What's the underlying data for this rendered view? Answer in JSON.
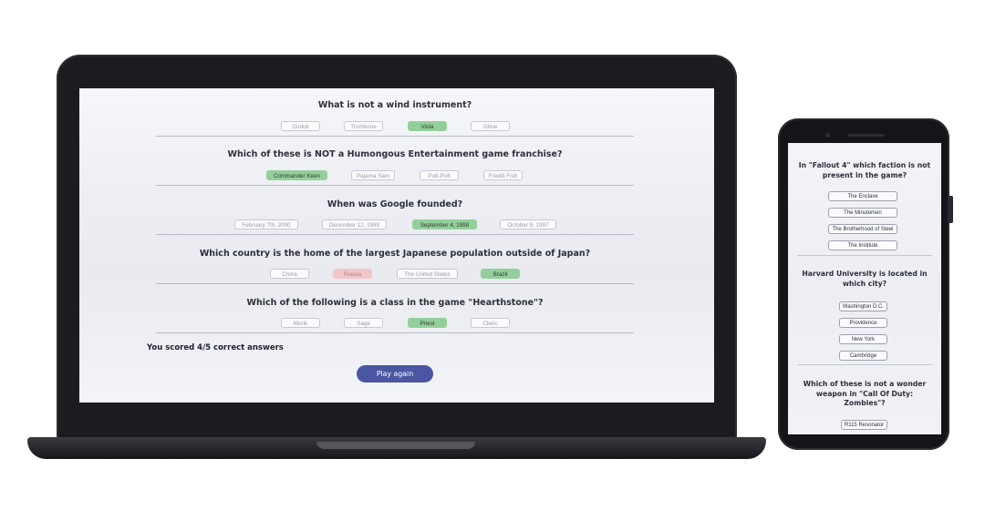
{
  "laptop": {
    "questions": [
      {
        "title": "What is not a wind instrument?",
        "options": [
          {
            "label": "Duduk",
            "state": "default"
          },
          {
            "label": "Trombone",
            "state": "default"
          },
          {
            "label": "Viola",
            "state": "correct"
          },
          {
            "label": "Oboe",
            "state": "default"
          }
        ]
      },
      {
        "title": "Which of these is NOT a Humongous Entertainment game franchise?",
        "options": [
          {
            "label": "Commander Keen",
            "state": "correct"
          },
          {
            "label": "Pajama Sam",
            "state": "default"
          },
          {
            "label": "Putt-Putt",
            "state": "default"
          },
          {
            "label": "Freddi Fish",
            "state": "default"
          }
        ]
      },
      {
        "title": "When was Google founded?",
        "options": [
          {
            "label": "February 7th, 2000",
            "state": "default"
          },
          {
            "label": "December 12, 1989",
            "state": "default"
          },
          {
            "label": "September 4, 1998",
            "state": "correct"
          },
          {
            "label": "October 9, 1997",
            "state": "default"
          }
        ]
      },
      {
        "title": "Which country is the home of the largest Japanese population outside of Japan?",
        "options": [
          {
            "label": "China",
            "state": "default"
          },
          {
            "label": "Russia",
            "state": "wrong"
          },
          {
            "label": "The United States",
            "state": "default"
          },
          {
            "label": "Brazil",
            "state": "correct"
          }
        ]
      },
      {
        "title": "Which of the following is a class in the game \"Hearthstone\"?",
        "options": [
          {
            "label": "Monk",
            "state": "default"
          },
          {
            "label": "Sage",
            "state": "default"
          },
          {
            "label": "Priest",
            "state": "correct"
          },
          {
            "label": "Cleric",
            "state": "default"
          }
        ]
      }
    ],
    "score_text": "You scored 4/5 correct answers",
    "play_again_label": "Play again"
  },
  "phone": {
    "questions": [
      {
        "title_lines": [
          "In \"Fallout 4\" which faction is not",
          "present in the game?"
        ],
        "options": [
          {
            "label": "The Enclave",
            "state": "default"
          },
          {
            "label": "The Minutemen",
            "state": "default"
          },
          {
            "label": "The Brotherhood of Steel",
            "state": "default"
          },
          {
            "label": "The Institute",
            "state": "chosen"
          }
        ]
      },
      {
        "title_lines": [
          "Harvard University is located in",
          "which city?"
        ],
        "options": [
          {
            "label": "Washington D.C.",
            "state": "default"
          },
          {
            "label": "Providence",
            "state": "default"
          },
          {
            "label": "New York",
            "state": "default"
          },
          {
            "label": "Cambridge",
            "state": "chosen"
          }
        ]
      },
      {
        "title_lines": [
          "Which of these is not a wonder",
          "weapon in \"Call Of Duty:",
          "Zombies\"?"
        ],
        "options": [
          {
            "label": "R115 Resonator",
            "state": "default"
          }
        ]
      }
    ]
  },
  "colors": {
    "correct": "#93cf9a",
    "wrong": "#f2c6c7",
    "chosen": "#c8cbee",
    "primary_button": "#4a56a1"
  }
}
